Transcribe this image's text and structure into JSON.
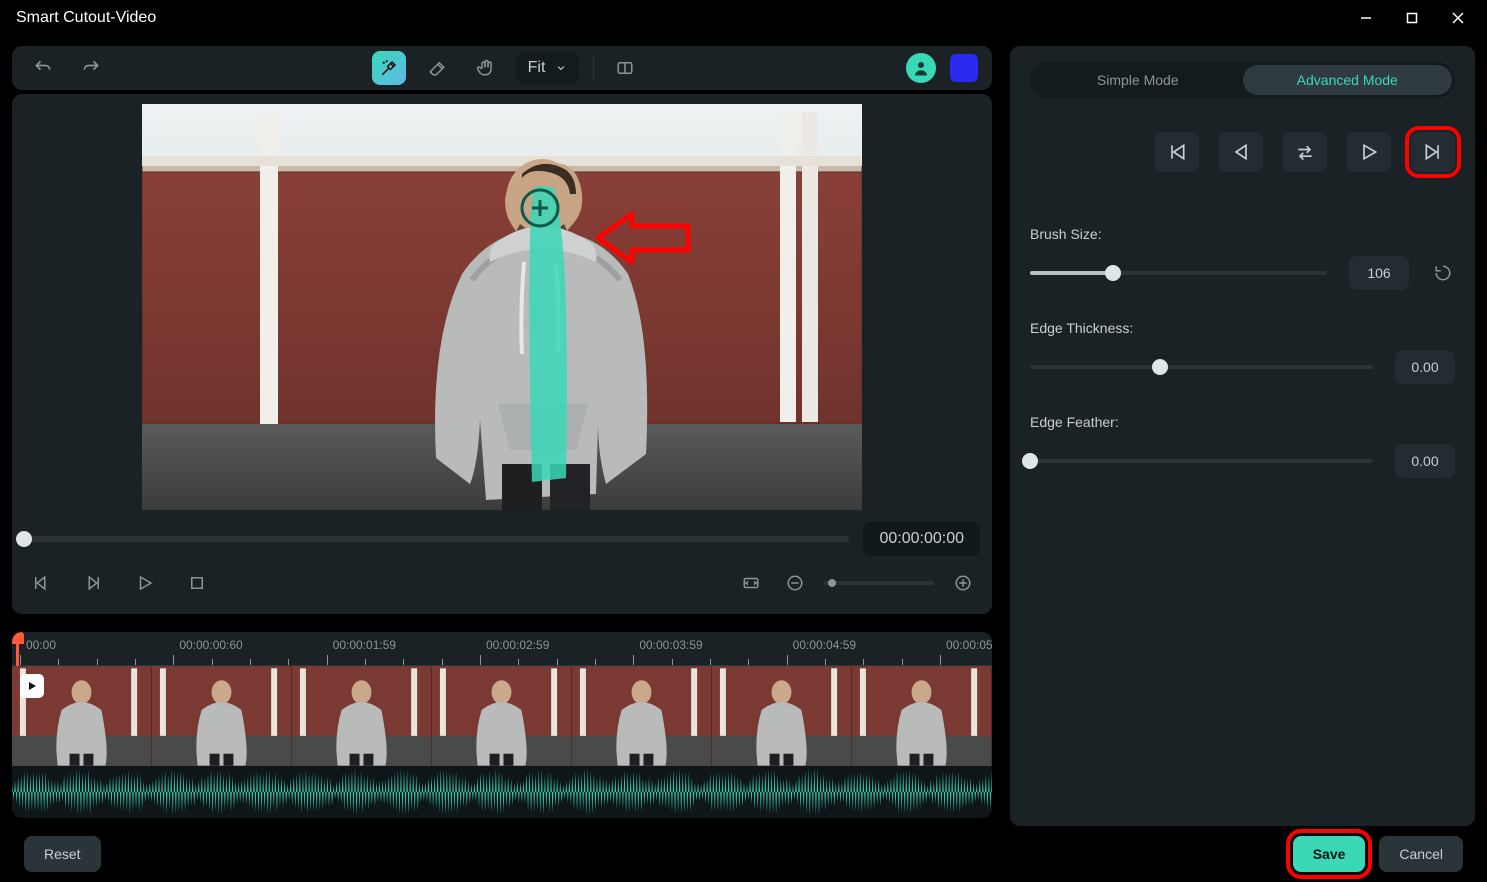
{
  "window": {
    "title": "Smart Cutout-Video"
  },
  "colors": {
    "accent": "#3ad8b7",
    "overlay_blue": "#2a2af0",
    "highlight_red": "#ff0000"
  },
  "toolbar": {
    "undo_icon": "undo",
    "redo_icon": "redo",
    "brush_icon": "magic-brush",
    "eraser_icon": "eraser",
    "hand_icon": "hand",
    "fit_label": "Fit",
    "compare_icon": "compare"
  },
  "preview": {
    "timecode": "00:00:00:00",
    "scrub_position_pct": 0,
    "zoom_value_pct": 8
  },
  "timeline": {
    "ticks": [
      "00:00",
      "00:00:00:60",
      "00:00:01:59",
      "00:00:02:59",
      "00:00:03:59",
      "00:00:04:59",
      "00:00:05"
    ],
    "playhead_pct": 0.5
  },
  "side": {
    "tabs": {
      "simple": "Simple Mode",
      "advanced": "Advanced Mode",
      "active": "advanced"
    },
    "nav": {
      "first": "go-first",
      "prev": "go-prev",
      "swap": "swap",
      "play": "play",
      "next": "go-next",
      "highlighted": "next"
    },
    "brush_size": {
      "label": "Brush Size:",
      "value": "106",
      "pct": 28
    },
    "edge_thickness": {
      "label": "Edge Thickness:",
      "value": "0.00",
      "pct": 38
    },
    "edge_feather": {
      "label": "Edge Feather:",
      "value": "0.00",
      "pct": 0
    }
  },
  "footer": {
    "reset": "Reset",
    "save": "Save",
    "cancel": "Cancel",
    "highlighted": "save"
  }
}
